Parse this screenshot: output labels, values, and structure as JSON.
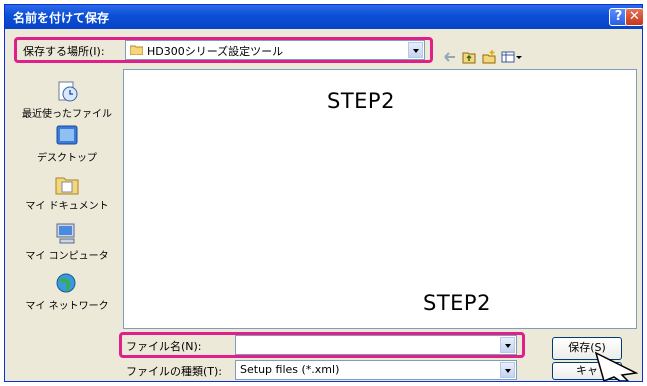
{
  "window": {
    "title": "名前を付けて保存"
  },
  "titlebar": {
    "help_glyph": "?",
    "close_glyph": "✕"
  },
  "location": {
    "label": "保存する場所(I):",
    "value": "HD300シリーズ設定ツール"
  },
  "places": [
    {
      "label": "最近使ったファイル",
      "icon": "recent-icon"
    },
    {
      "label": "デスクトップ",
      "icon": "desktop-icon"
    },
    {
      "label": "マイ ドキュメント",
      "icon": "documents-icon"
    },
    {
      "label": "マイ コンピュータ",
      "icon": "computer-icon"
    },
    {
      "label": "マイ ネットワーク",
      "icon": "network-icon"
    }
  ],
  "annotations": {
    "step_top": "STEP2",
    "step_bottom": "STEP2"
  },
  "filename": {
    "label": "ファイル名(N):",
    "value": ""
  },
  "filetype": {
    "label": "ファイルの種類(T):",
    "value": "Setup files (*.xml)"
  },
  "buttons": {
    "save": "保存(S)",
    "cancel": "キャ"
  },
  "colors": {
    "highlight": "#e0208a",
    "titlebar": "#0a4fd6"
  }
}
